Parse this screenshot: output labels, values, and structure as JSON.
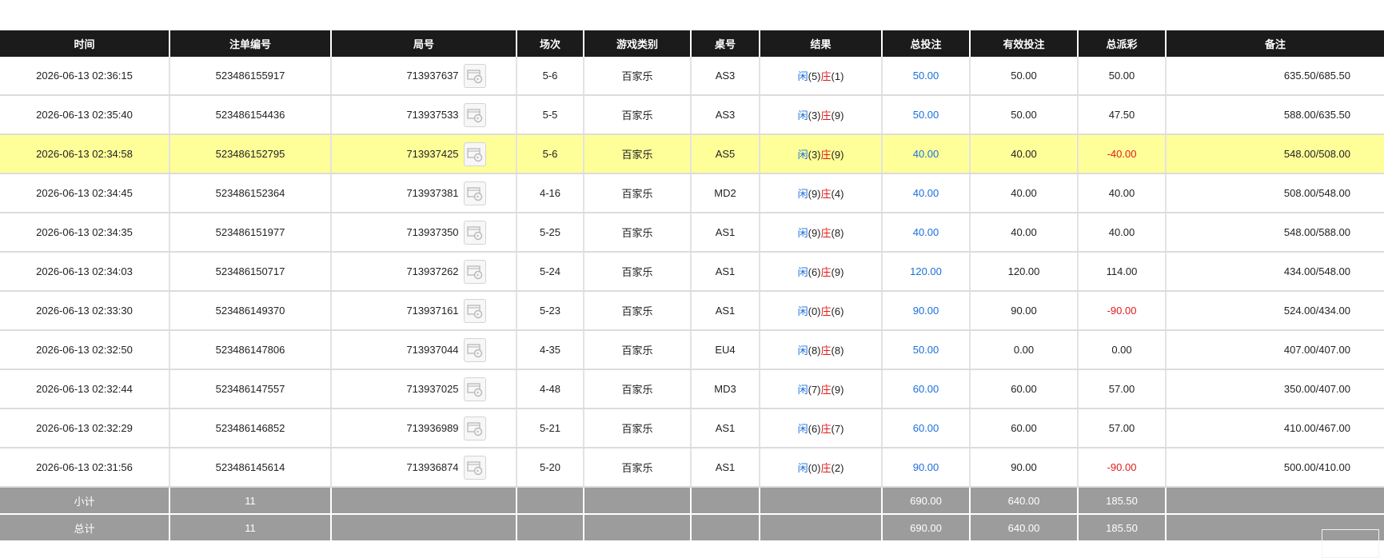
{
  "columns": {
    "time": "时间",
    "bet_no": "注单编号",
    "round_no": "局号",
    "shoe": "场次",
    "game_type": "游戏类别",
    "table": "桌号",
    "result": "结果",
    "total_bet": "总投注",
    "valid_bet": "有效投注",
    "payout": "总派彩",
    "remark": "备注"
  },
  "result_labels": {
    "player": "闲",
    "banker": "庄"
  },
  "colors": {
    "header_bg": "#1b1b1b",
    "highlight_row": "#ffff99",
    "total_bg": "#9c9c9c",
    "blue": "#1a6fdc",
    "red": "#e01b1b"
  },
  "rows": [
    {
      "time": "2026-06-13 02:36:15",
      "bet_no": "523486155917",
      "round_no": "713937637",
      "shoe": "5-6",
      "game_type": "百家乐",
      "table": "AS3",
      "player": "(5)",
      "banker": "(1)",
      "total_bet": "50.00",
      "valid_bet": "50.00",
      "payout": "50.00",
      "payout_negative": false,
      "remark": "635.50/685.50",
      "highlight": false
    },
    {
      "time": "2026-06-13 02:35:40",
      "bet_no": "523486154436",
      "round_no": "713937533",
      "shoe": "5-5",
      "game_type": "百家乐",
      "table": "AS3",
      "player": "(3)",
      "banker": "(9)",
      "total_bet": "50.00",
      "valid_bet": "50.00",
      "payout": "47.50",
      "payout_negative": false,
      "remark": "588.00/635.50",
      "highlight": false
    },
    {
      "time": "2026-06-13 02:34:58",
      "bet_no": "523486152795",
      "round_no": "713937425",
      "shoe": "5-6",
      "game_type": "百家乐",
      "table": "AS5",
      "player": "(3)",
      "banker": "(9)",
      "total_bet": "40.00",
      "valid_bet": "40.00",
      "payout": "-40.00",
      "payout_negative": true,
      "remark": "548.00/508.00",
      "highlight": true
    },
    {
      "time": "2026-06-13 02:34:45",
      "bet_no": "523486152364",
      "round_no": "713937381",
      "shoe": "4-16",
      "game_type": "百家乐",
      "table": "MD2",
      "player": "(9)",
      "banker": "(4)",
      "total_bet": "40.00",
      "valid_bet": "40.00",
      "payout": "40.00",
      "payout_negative": false,
      "remark": "508.00/548.00",
      "highlight": false
    },
    {
      "time": "2026-06-13 02:34:35",
      "bet_no": "523486151977",
      "round_no": "713937350",
      "shoe": "5-25",
      "game_type": "百家乐",
      "table": "AS1",
      "player": "(9)",
      "banker": "(8)",
      "total_bet": "40.00",
      "valid_bet": "40.00",
      "payout": "40.00",
      "payout_negative": false,
      "remark": "548.00/588.00",
      "highlight": false
    },
    {
      "time": "2026-06-13 02:34:03",
      "bet_no": "523486150717",
      "round_no": "713937262",
      "shoe": "5-24",
      "game_type": "百家乐",
      "table": "AS1",
      "player": "(6)",
      "banker": "(9)",
      "total_bet": "120.00",
      "valid_bet": "120.00",
      "payout": "114.00",
      "payout_negative": false,
      "remark": "434.00/548.00",
      "highlight": false
    },
    {
      "time": "2026-06-13 02:33:30",
      "bet_no": "523486149370",
      "round_no": "713937161",
      "shoe": "5-23",
      "game_type": "百家乐",
      "table": "AS1",
      "player": "(0)",
      "banker": "(6)",
      "total_bet": "90.00",
      "valid_bet": "90.00",
      "payout": "-90.00",
      "payout_negative": true,
      "remark": "524.00/434.00",
      "highlight": false
    },
    {
      "time": "2026-06-13 02:32:50",
      "bet_no": "523486147806",
      "round_no": "713937044",
      "shoe": "4-35",
      "game_type": "百家乐",
      "table": "EU4",
      "player": "(8)",
      "banker": "(8)",
      "total_bet": "50.00",
      "valid_bet": "0.00",
      "payout": "0.00",
      "payout_negative": false,
      "remark": "407.00/407.00",
      "highlight": false
    },
    {
      "time": "2026-06-13 02:32:44",
      "bet_no": "523486147557",
      "round_no": "713937025",
      "shoe": "4-48",
      "game_type": "百家乐",
      "table": "MD3",
      "player": "(7)",
      "banker": "(9)",
      "total_bet": "60.00",
      "valid_bet": "60.00",
      "payout": "57.00",
      "payout_negative": false,
      "remark": "350.00/407.00",
      "highlight": false
    },
    {
      "time": "2026-06-13 02:32:29",
      "bet_no": "523486146852",
      "round_no": "713936989",
      "shoe": "5-21",
      "game_type": "百家乐",
      "table": "AS1",
      "player": "(6)",
      "banker": "(7)",
      "total_bet": "60.00",
      "valid_bet": "60.00",
      "payout": "57.00",
      "payout_negative": false,
      "remark": "410.00/467.00",
      "highlight": false
    },
    {
      "time": "2026-06-13 02:31:56",
      "bet_no": "523486145614",
      "round_no": "713936874",
      "shoe": "5-20",
      "game_type": "百家乐",
      "table": "AS1",
      "player": "(0)",
      "banker": "(2)",
      "total_bet": "90.00",
      "valid_bet": "90.00",
      "payout": "-90.00",
      "payout_negative": true,
      "remark": "500.00/410.00",
      "highlight": false
    }
  ],
  "subtotal": {
    "label": "小计",
    "count": "11",
    "total_bet": "690.00",
    "valid_bet": "640.00",
    "payout": "185.50"
  },
  "grand_total": {
    "label": "总计",
    "count": "11",
    "total_bet": "690.00",
    "valid_bet": "640.00",
    "payout": "185.50"
  },
  "round_icon": "video-replay-icon"
}
